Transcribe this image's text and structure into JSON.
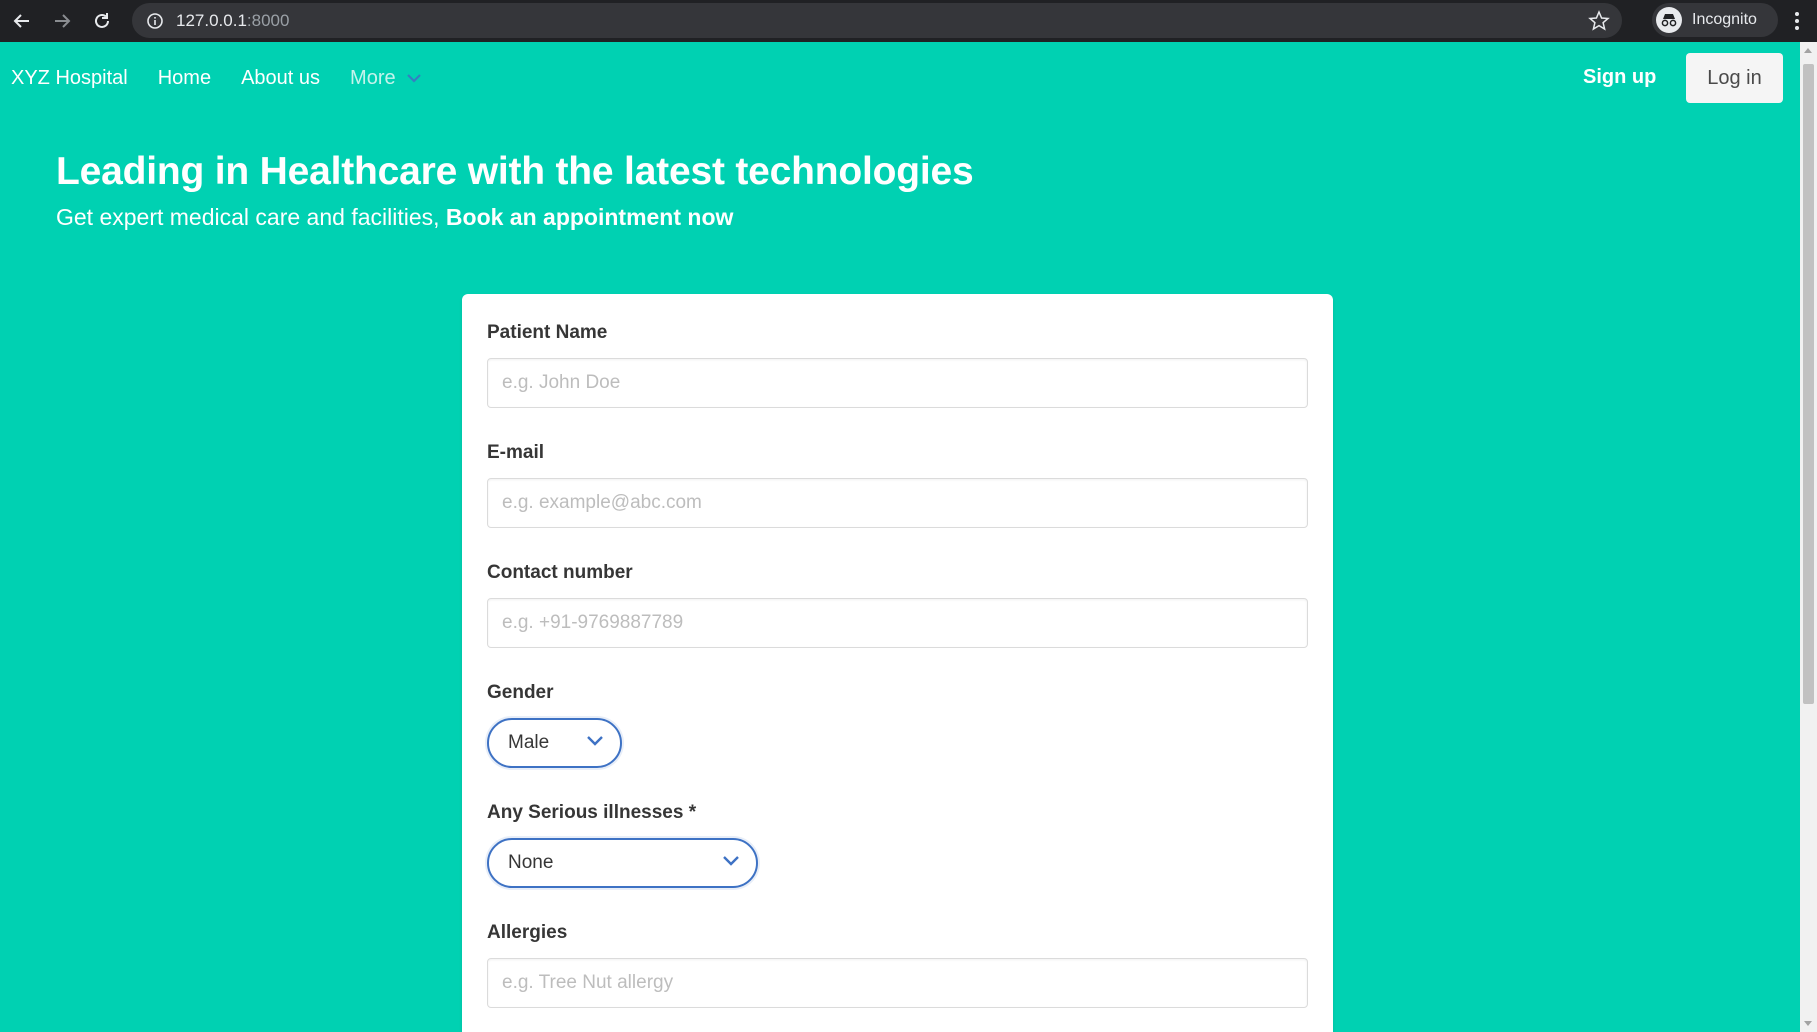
{
  "browser": {
    "url_host": "127.0.0.1",
    "url_port": ":8000",
    "profile_label": "Incognito"
  },
  "navbar": {
    "brand": "XYZ Hospital",
    "items": [
      {
        "label": "Home"
      },
      {
        "label": "About us"
      }
    ],
    "more_label": "More",
    "signup_label": "Sign up",
    "login_label": "Log in"
  },
  "hero": {
    "title": "Leading in Healthcare with the latest technologies",
    "subtitle_text": "Get expert medical care and facilities, ",
    "subtitle_cta": "Book an appointment now"
  },
  "form": {
    "patient_name": {
      "label": "Patient Name",
      "placeholder": "e.g. John Doe"
    },
    "email": {
      "label": "E-mail",
      "placeholder": "e.g. example@abc.com"
    },
    "contact": {
      "label": "Contact number",
      "placeholder": "e.g. +91-9769887789"
    },
    "gender": {
      "label": "Gender",
      "value": "Male"
    },
    "illnesses": {
      "label": "Any Serious illnesses *",
      "value": "None"
    },
    "allergies": {
      "label": "Allergies",
      "placeholder": "e.g. Tree Nut allergy"
    }
  },
  "colors": {
    "page_bg": "#00d1b2",
    "select_border": "#3e72c4"
  }
}
